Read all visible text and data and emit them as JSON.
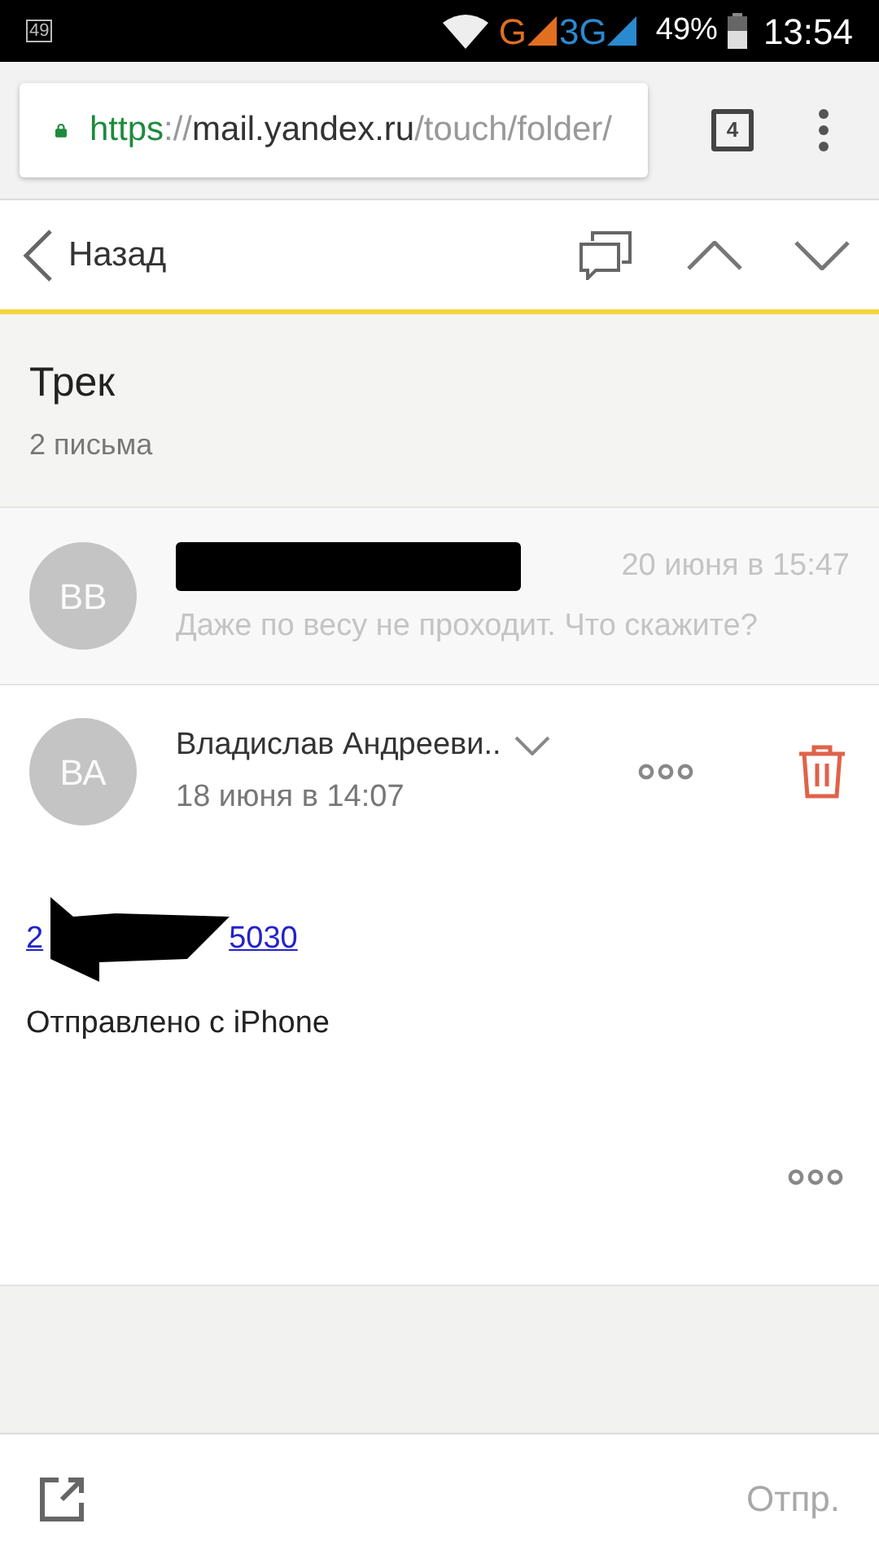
{
  "status_bar": {
    "notification": "49",
    "network_1": "G",
    "network_2": "3G",
    "battery": "49%",
    "time": "13:54"
  },
  "browser": {
    "url_scheme": "https",
    "url_sep": "://",
    "url_host": "mail.yandex.ru",
    "url_path": "/touch/folder/",
    "tab_count": "4"
  },
  "toolbar": {
    "back": "Назад"
  },
  "thread": {
    "title": "Трек",
    "count": "2 письма"
  },
  "messages": [
    {
      "kind": "collapsed",
      "initials": "ВВ",
      "date": "20 июня в 15:47",
      "snippet": "Даже по весу не проходит. Что скажите?"
    },
    {
      "kind": "expanded",
      "initials": "ВА",
      "sender": "Владислав Андрееви..",
      "date": "18 июня в 14:07",
      "link_start": "2",
      "link_end": "5030",
      "body": "Отправлено с iPhone"
    }
  ],
  "bottom_bar": {
    "send": "Отпр."
  }
}
